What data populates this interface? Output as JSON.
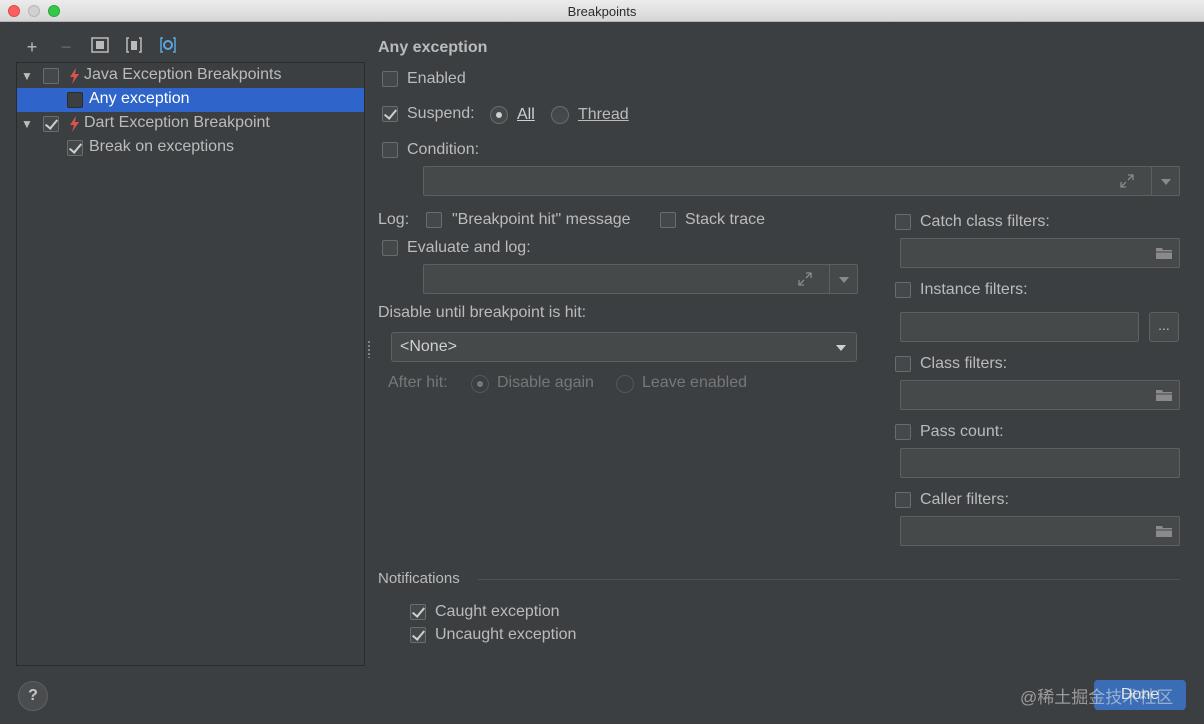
{
  "window": {
    "title": "Breakpoints"
  },
  "toolbar": {
    "add": "+",
    "remove": "−"
  },
  "tree": {
    "java_group": "Java Exception Breakpoints",
    "any_exception": "Any exception",
    "dart_group": "Dart Exception Breakpoint",
    "break_on_exceptions": "Break on exceptions"
  },
  "detail": {
    "heading": "Any exception",
    "enabled": "Enabled",
    "suspend": "Suspend:",
    "suspend_all": "All",
    "suspend_thread": "Thread",
    "condition": "Condition:",
    "log": "Log:",
    "log_message": "\"Breakpoint hit\" message",
    "stack_trace": "Stack trace",
    "evaluate_and_log": "Evaluate and log:",
    "disable_until": "Disable until breakpoint is hit:",
    "disable_until_value": "<None>",
    "after_hit": "After hit:",
    "disable_again": "Disable again",
    "leave_enabled": "Leave enabled",
    "more": "..."
  },
  "filters": {
    "catch_class": "Catch class filters:",
    "instance": "Instance filters:",
    "class": "Class filters:",
    "pass_count": "Pass count:",
    "caller": "Caller filters:"
  },
  "notifications": {
    "heading": "Notifications",
    "caught": "Caught exception",
    "uncaught": "Uncaught exception"
  },
  "footer": {
    "help": "?",
    "done": "Done",
    "watermark": "@稀土掘金技术社区"
  }
}
